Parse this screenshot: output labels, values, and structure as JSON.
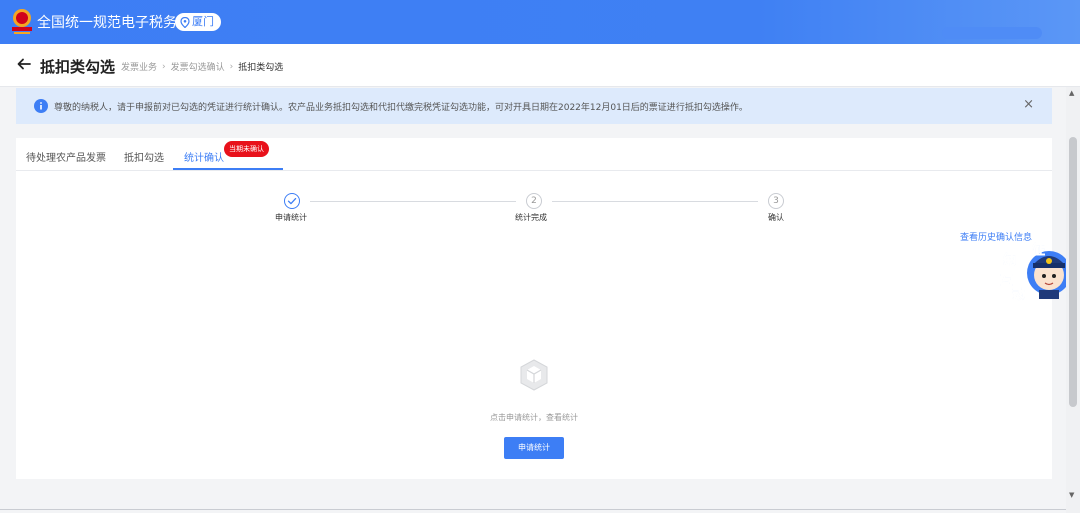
{
  "app": {
    "title": "全国统一规范电子税务局",
    "city": "厦门",
    "logo_icon": "tax-emblem-icon",
    "accent_color": "#3d7ef5"
  },
  "header": {
    "title": "抵扣类勾选",
    "breadcrumb": [
      "发票业务",
      "发票勾选确认",
      "抵扣类勾选"
    ]
  },
  "notice": {
    "text": "尊敬的纳税人，请于申报前对已勾选的凭证进行统计确认。农产品业务抵扣勾选和代扣代缴完税凭证勾选功能，可对开具日期在2022年12月01日后的票证进行抵扣勾选操作。",
    "close": "×"
  },
  "tabs": [
    {
      "label": "待处理农产品发票"
    },
    {
      "label": "抵扣勾选"
    },
    {
      "label": "统计确认",
      "badge": "当期未确认",
      "active": true
    }
  ],
  "steps": [
    {
      "label": "申请统计",
      "marker": "✓",
      "status": "done"
    },
    {
      "label": "统计完成",
      "marker": "2",
      "status": "pending"
    },
    {
      "label": "确认",
      "marker": "3",
      "status": "pending"
    }
  ],
  "history_link": "查看历史确认信息",
  "empty": {
    "text": "点击申请统计，查看统计",
    "button": "申请统计"
  },
  "mascot": {
    "chars": [
      "征",
      "纳",
      "互",
      "动"
    ]
  }
}
